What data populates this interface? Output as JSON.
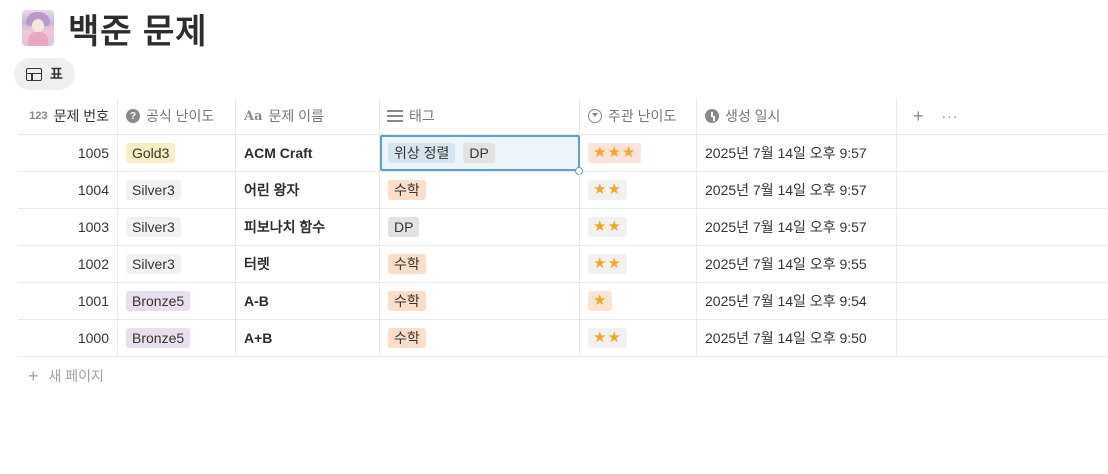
{
  "page": {
    "title": "백준 문제",
    "icon": "anime-avatar-icon"
  },
  "view": {
    "label": "표",
    "icon": "table-icon"
  },
  "columns": [
    {
      "label": "문제 번호",
      "icon": "number-icon",
      "icon_text": "123"
    },
    {
      "label": "공식 난이도",
      "icon": "help-circle-icon",
      "icon_text": "?"
    },
    {
      "label": "문제 이름",
      "icon": "text-icon",
      "icon_text": "Aa"
    },
    {
      "label": "태그",
      "icon": "list-icon"
    },
    {
      "label": "주관 난이도",
      "icon": "select-icon"
    },
    {
      "label": "생성 일시",
      "icon": "clock-icon"
    }
  ],
  "header_actions": {
    "add": "+",
    "more": "···"
  },
  "rows": [
    {
      "number": "1005",
      "tier": "Gold3",
      "tier_color": "gold",
      "name": "ACM Craft",
      "tags": [
        {
          "text": "위상 정렬",
          "color": "blue"
        },
        {
          "text": "DP",
          "color": "gray"
        }
      ],
      "stars": "★★★",
      "stars_color": "red",
      "created": "2025년 7월 14일 오후 9:57"
    },
    {
      "number": "1004",
      "tier": "Silver3",
      "tier_color": "silver",
      "name": "어린 왕자",
      "tags": [
        {
          "text": "수학",
          "color": "orange"
        }
      ],
      "stars": "★★",
      "stars_color": "gray",
      "created": "2025년 7월 14일 오후 9:57"
    },
    {
      "number": "1003",
      "tier": "Silver3",
      "tier_color": "silver",
      "name": "피보나치 함수",
      "tags": [
        {
          "text": "DP",
          "color": "gray"
        }
      ],
      "stars": "★★",
      "stars_color": "gray",
      "created": "2025년 7월 14일 오후 9:57"
    },
    {
      "number": "1002",
      "tier": "Silver3",
      "tier_color": "silver",
      "name": "터렛",
      "tags": [
        {
          "text": "수학",
          "color": "orange"
        }
      ],
      "stars": "★★",
      "stars_color": "gray",
      "created": "2025년 7월 14일 오후 9:55"
    },
    {
      "number": "1001",
      "tier": "Bronze5",
      "tier_color": "bronze",
      "name": "A-B",
      "tags": [
        {
          "text": "수학",
          "color": "orange"
        }
      ],
      "stars": "★",
      "stars_color": "gray",
      "created": "2025년 7월 14일 오후 9:54"
    },
    {
      "number": "1000",
      "tier": "Bronze5",
      "tier_color": "bronze",
      "name": "A+B",
      "tags": [
        {
          "text": "수학",
          "color": "orange"
        }
      ],
      "stars": "★★",
      "stars_color": "gray",
      "created": "2025년 7월 14일 오후 9:50"
    }
  ],
  "new_page": {
    "plus": "+",
    "label": "새 페이지"
  },
  "colors": {
    "selection": "#5f9fd6",
    "star": "#f5a623",
    "text": "#37352f",
    "muted": "#787774"
  }
}
